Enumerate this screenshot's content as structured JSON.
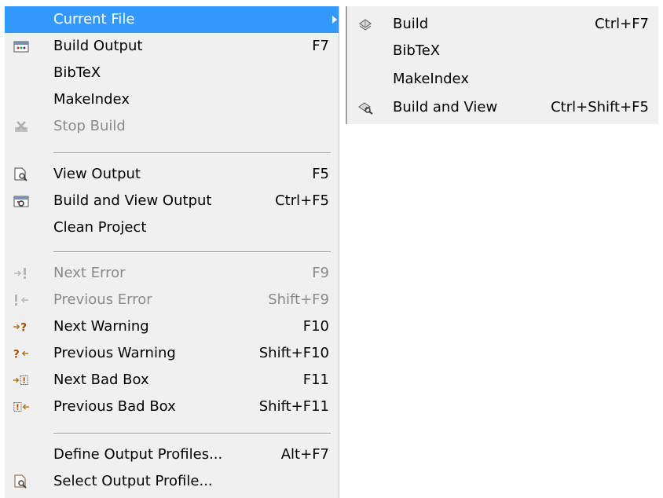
{
  "main_menu": {
    "items": [
      {
        "label": "Current File",
        "shortcut": "",
        "icon": "none"
      },
      {
        "label": "Build Output",
        "shortcut": "F7",
        "icon": "build-output-icon"
      },
      {
        "label": "BibTeX",
        "shortcut": "",
        "icon": "none"
      },
      {
        "label": "MakeIndex",
        "shortcut": "",
        "icon": "none"
      },
      {
        "label": "Stop Build",
        "shortcut": "",
        "icon": "stop-build-icon"
      },
      {
        "label": "View Output",
        "shortcut": "F5",
        "icon": "view-output-icon"
      },
      {
        "label": "Build and View Output",
        "shortcut": "Ctrl+F5",
        "icon": "build-view-output-icon"
      },
      {
        "label": "Clean Project",
        "shortcut": "",
        "icon": "none"
      },
      {
        "label": "Next Error",
        "shortcut": "F9",
        "icon": "next-error-icon"
      },
      {
        "label": "Previous Error",
        "shortcut": "Shift+F9",
        "icon": "previous-error-icon"
      },
      {
        "label": "Next Warning",
        "shortcut": "F10",
        "icon": "next-warning-icon"
      },
      {
        "label": "Previous Warning",
        "shortcut": "Shift+F10",
        "icon": "previous-warning-icon"
      },
      {
        "label": "Next Bad Box",
        "shortcut": "F11",
        "icon": "next-bad-box-icon"
      },
      {
        "label": "Previous Bad Box",
        "shortcut": "Shift+F11",
        "icon": "previous-bad-box-icon"
      },
      {
        "label": "Define Output Profiles...",
        "shortcut": "Alt+F7",
        "icon": "none"
      },
      {
        "label": "Select Output Profile...",
        "shortcut": "",
        "icon": "select-output-profile-icon"
      }
    ]
  },
  "sub_menu": {
    "items": [
      {
        "label": "Build",
        "shortcut": "Ctrl+F7",
        "icon": "build-icon"
      },
      {
        "label": "BibTeX",
        "shortcut": "",
        "icon": "none"
      },
      {
        "label": "MakeIndex",
        "shortcut": "",
        "icon": "none"
      },
      {
        "label": "Build and View",
        "shortcut": "Ctrl+Shift+F5",
        "icon": "build-and-view-icon"
      }
    ]
  },
  "colors": {
    "selection": "#3399ff",
    "menu_background": "#f0f0f0",
    "disabled_text": "#8a8a8a"
  }
}
